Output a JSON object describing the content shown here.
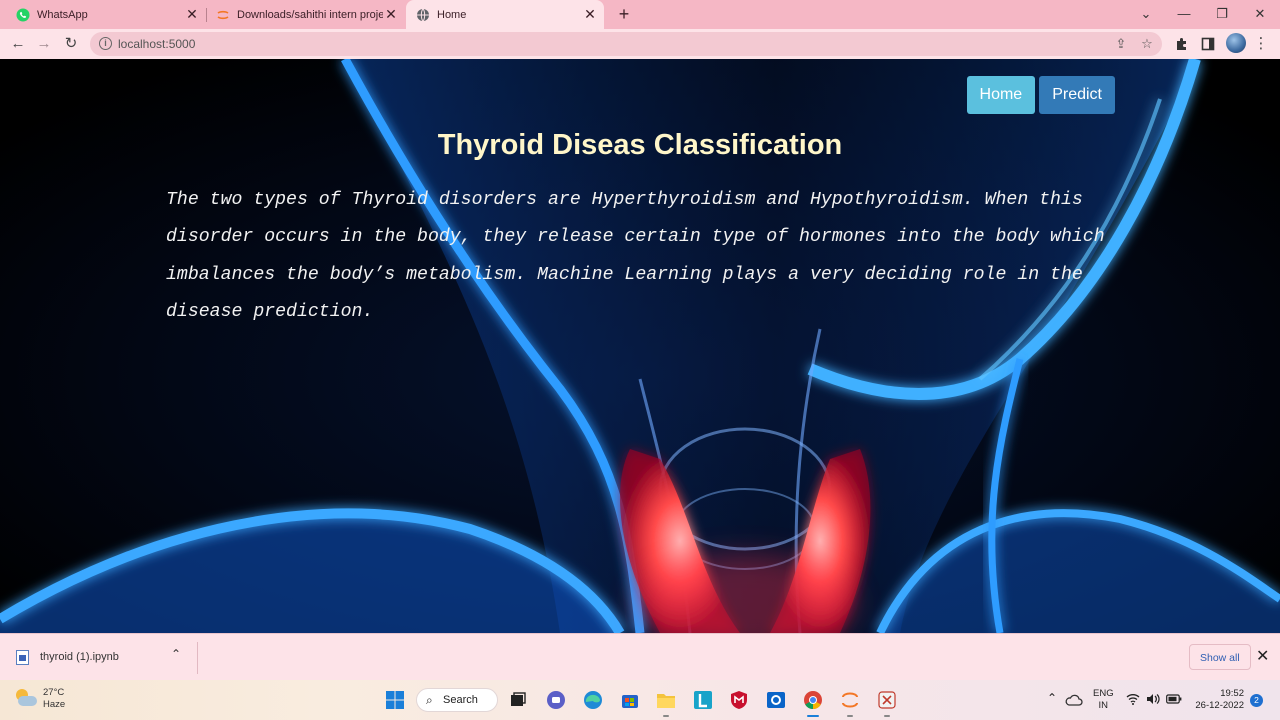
{
  "browser": {
    "tabs": [
      {
        "title": "WhatsApp",
        "active": false
      },
      {
        "title": "Downloads/sahithi intern project",
        "active": false
      },
      {
        "title": "Home",
        "active": true
      }
    ],
    "url": "localhost:5000"
  },
  "page": {
    "nav": [
      {
        "label": "Home",
        "color": "#5bc0de"
      },
      {
        "label": "Predict",
        "color": "#337ab7"
      }
    ],
    "heading": "Thyroid Diseas Classification",
    "paragraph": "The two types of Thyroid disorders are Hyperthyroidism and Hypothyroidism. When this disorder occurs in the body, they release certain type of hormones into the body which imbalances the body’s metabolism. Machine Learning plays a very deciding role in the disease prediction.",
    "background": "glowing-neck-thyroid-xray"
  },
  "downloads": {
    "file": "thyroid (1).ipynb",
    "show_all": "Show all"
  },
  "taskbar": {
    "weather_temp": "27°C",
    "weather_desc": "Haze",
    "search_label": "Search",
    "lang_top": "ENG",
    "lang_bottom": "IN",
    "time": "19:52",
    "date": "26-12-2022",
    "notification_count": "2"
  }
}
